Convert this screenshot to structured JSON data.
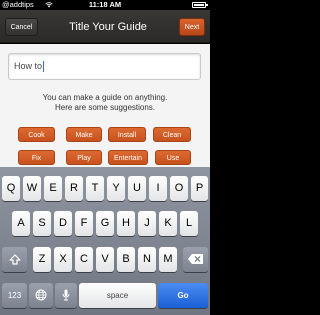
{
  "status_bar": {
    "carrier": "@addtips",
    "time": "11:18 AM"
  },
  "nav": {
    "cancel_label": "Cancel",
    "title": "Title Your Guide",
    "next_label": "Next"
  },
  "input": {
    "value": "How to"
  },
  "help": {
    "line1": "You can make a guide on anything.",
    "line2": "Here are some suggestions."
  },
  "suggestions": [
    "Cook",
    "Make",
    "Install",
    "Clean",
    "Fix",
    "Play",
    "Entertain",
    "Use"
  ],
  "keyboard": {
    "row1": [
      "Q",
      "W",
      "E",
      "R",
      "T",
      "Y",
      "U",
      "I",
      "O",
      "P"
    ],
    "row2": [
      "A",
      "S",
      "D",
      "F",
      "G",
      "H",
      "J",
      "K",
      "L"
    ],
    "row3": [
      "Z",
      "X",
      "C",
      "V",
      "B",
      "N",
      "M"
    ],
    "numbers_label": "123",
    "space_label": "space",
    "go_label": "Go"
  },
  "colors": {
    "accent": "#d35a24",
    "keyboard_bg": "#7f8692",
    "go_blue": "#2f74e2"
  }
}
